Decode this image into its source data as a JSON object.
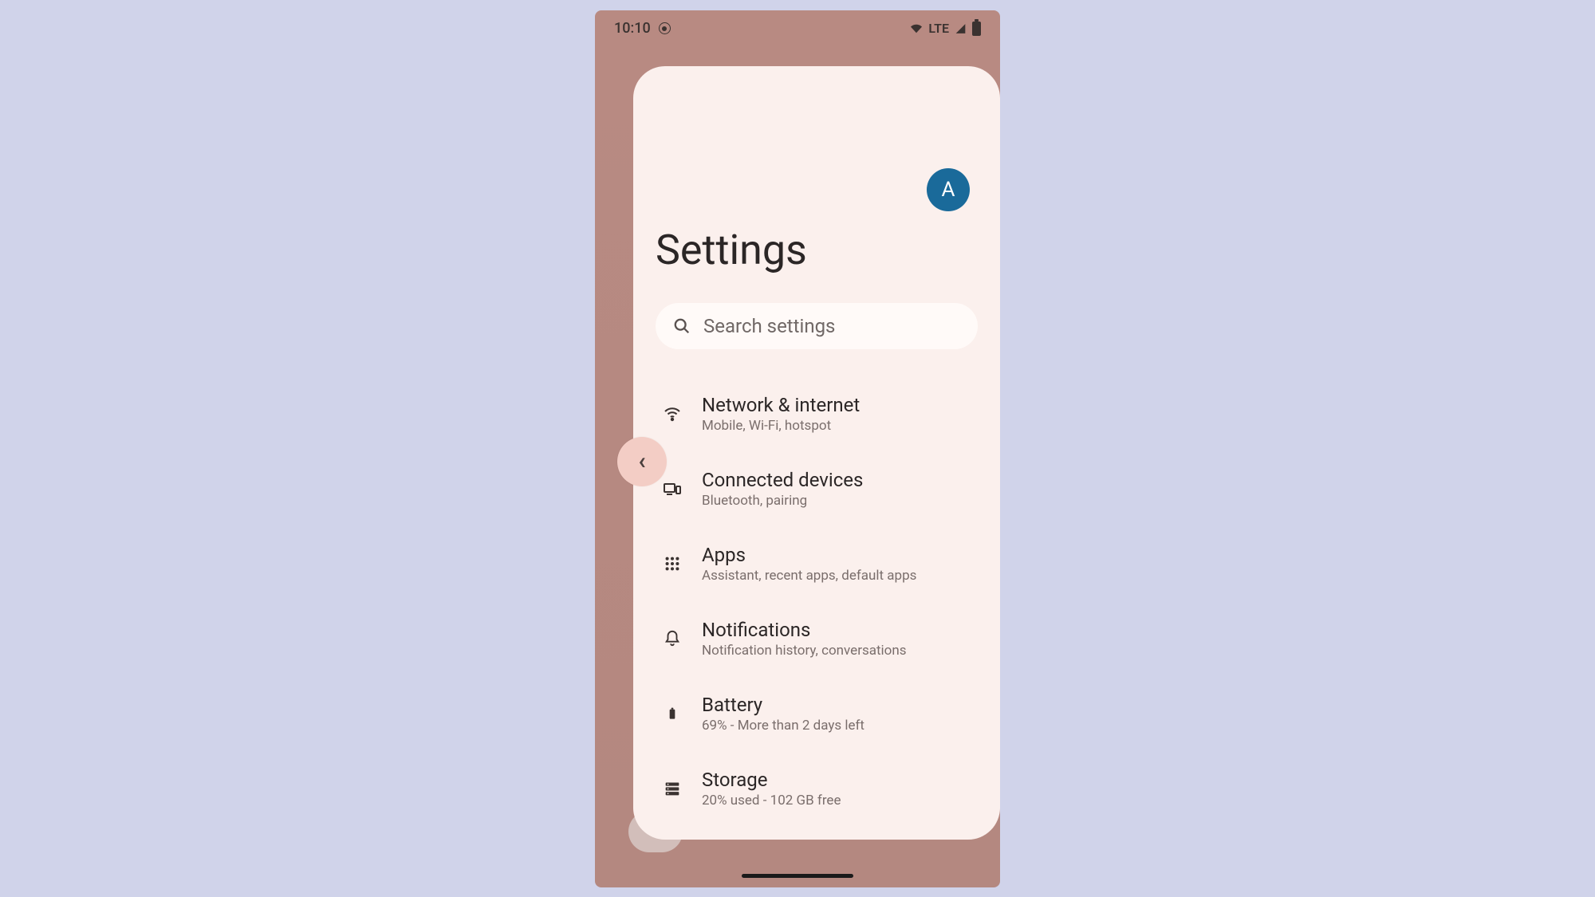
{
  "status": {
    "time": "10:10",
    "network_label": "LTE"
  },
  "header": {
    "title": "Settings",
    "avatar_initial": "A"
  },
  "search": {
    "placeholder": "Search settings"
  },
  "items": [
    {
      "icon": "wifi-icon",
      "title": "Network & internet",
      "subtitle": "Mobile, Wi-Fi, hotspot"
    },
    {
      "icon": "devices-icon",
      "title": "Connected devices",
      "subtitle": "Bluetooth, pairing"
    },
    {
      "icon": "apps-icon",
      "title": "Apps",
      "subtitle": "Assistant, recent apps, default apps"
    },
    {
      "icon": "bell-icon",
      "title": "Notifications",
      "subtitle": "Notification history, conversations"
    },
    {
      "icon": "battery-icon",
      "title": "Battery",
      "subtitle": "69% - More than 2 days left"
    },
    {
      "icon": "storage-icon",
      "title": "Storage",
      "subtitle": "20% used - 102 GB free"
    }
  ]
}
